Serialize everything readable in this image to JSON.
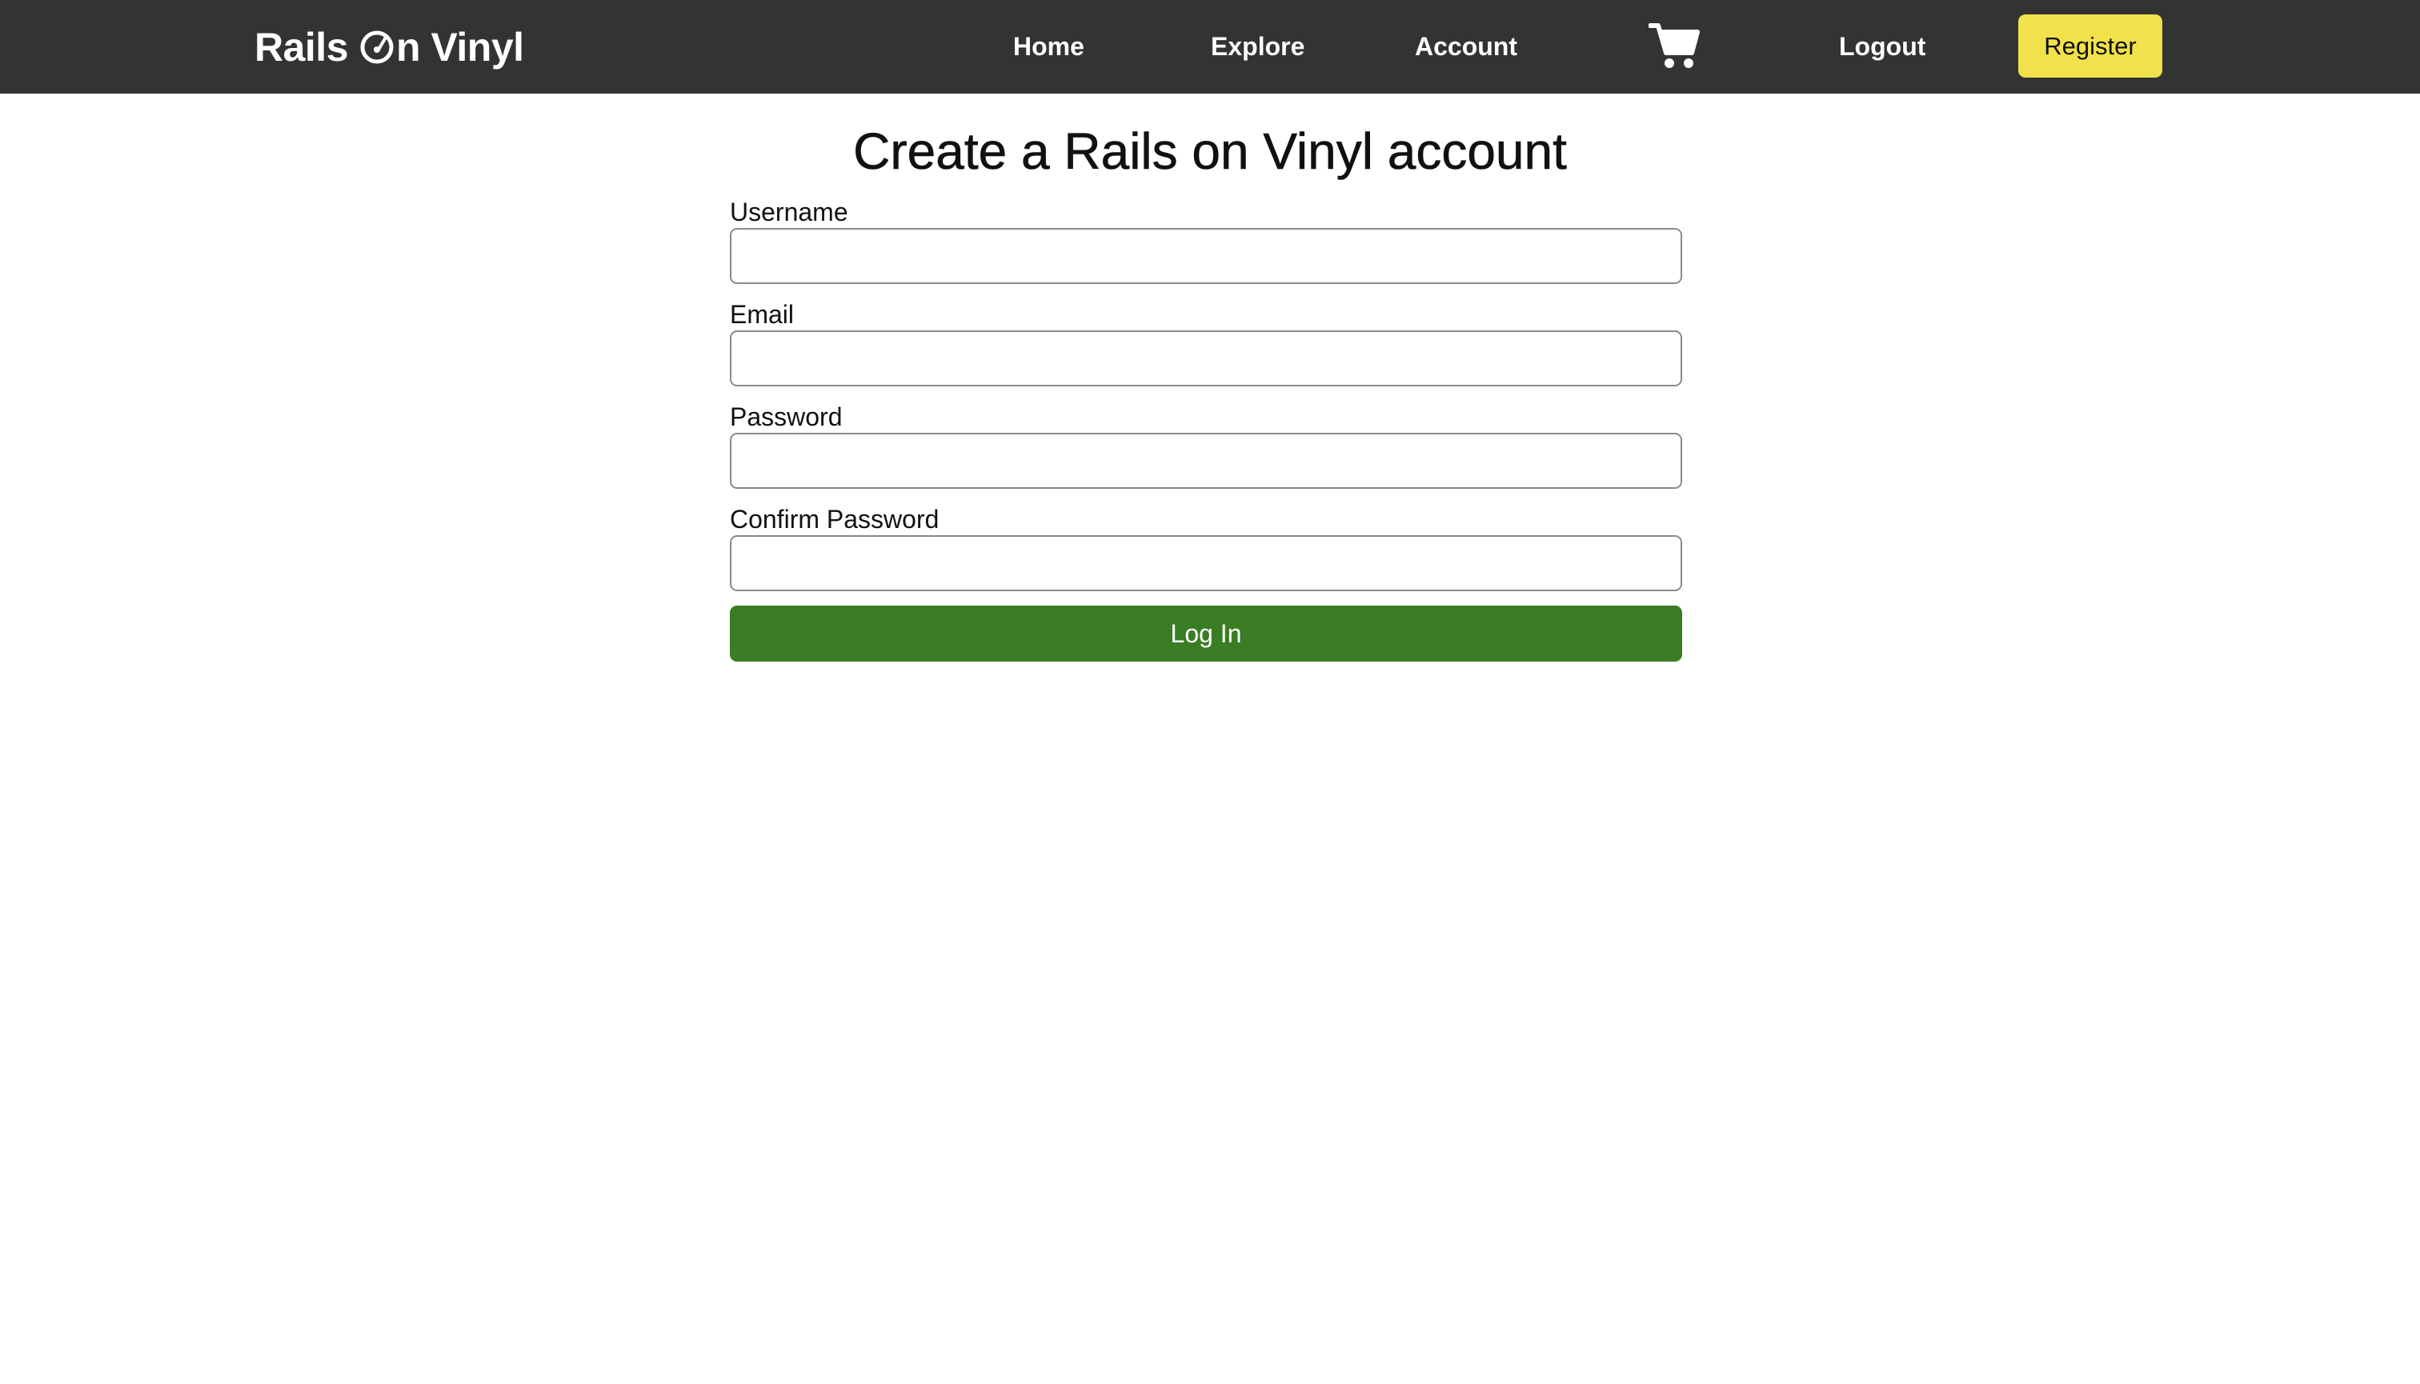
{
  "navbar": {
    "brand_prefix": "Rails",
    "brand_suffix": "n Vinyl",
    "links": {
      "home": "Home",
      "explore": "Explore",
      "account": "Account",
      "logout": "Logout"
    },
    "cart_icon": "shopping-cart-icon",
    "register_label": "Register",
    "colors": {
      "background": "#333333",
      "register_bg": "#f1e14a"
    }
  },
  "main": {
    "title": "Create a Rails on Vinyl account",
    "fields": {
      "username": {
        "label": "Username",
        "value": ""
      },
      "email": {
        "label": "Email",
        "value": ""
      },
      "password": {
        "label": "Password",
        "value": ""
      },
      "confirm_password": {
        "label": "Confirm Password",
        "value": ""
      }
    },
    "submit_label": "Log In",
    "colors": {
      "submit_bg": "#3a7d24"
    }
  }
}
